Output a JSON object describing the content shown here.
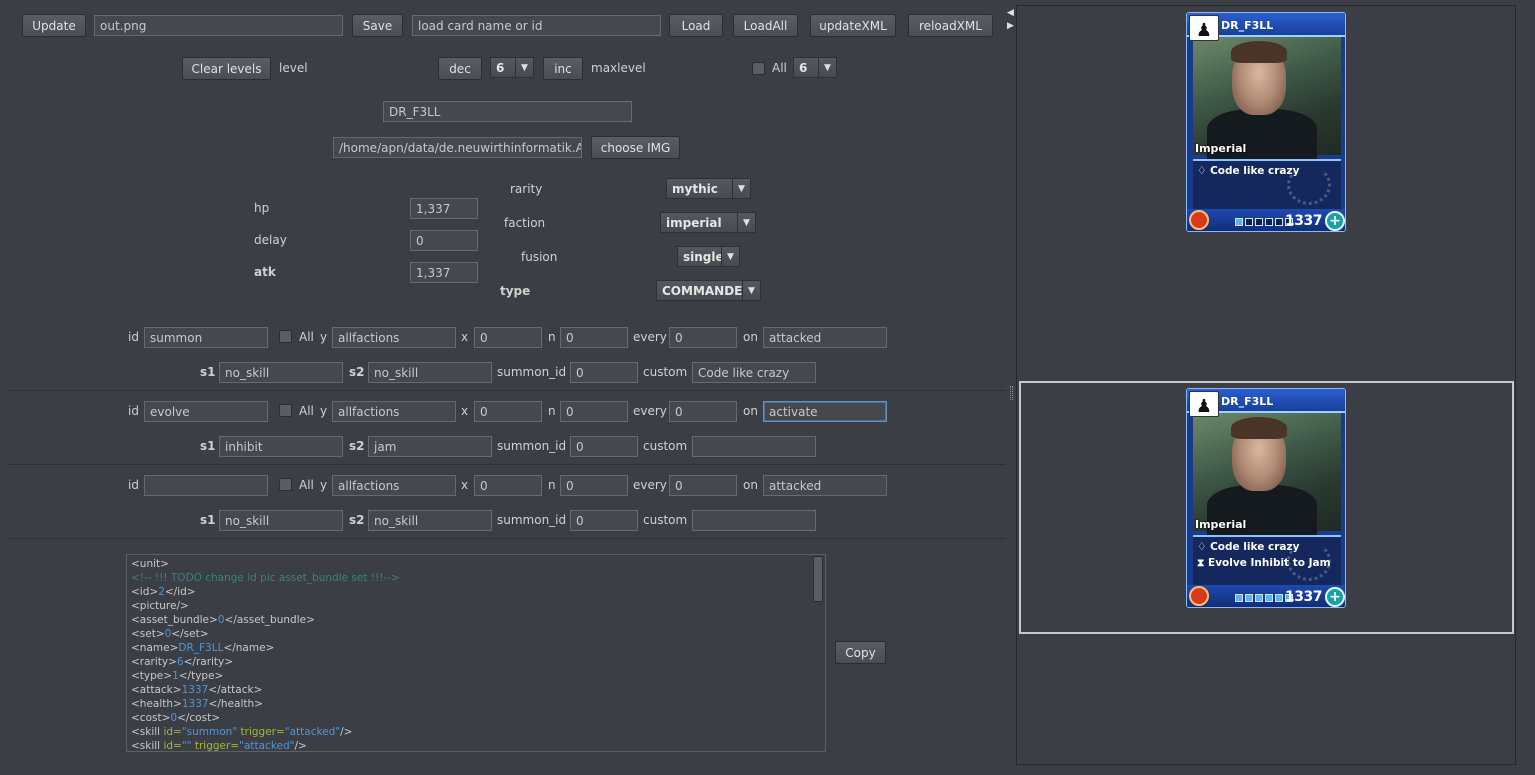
{
  "toolbar": {
    "update": "Update",
    "filename": "out.png",
    "save": "Save",
    "load_placeholder": "load card name or id",
    "load": "Load",
    "load_all": "LoadAll",
    "update_xml": "updateXML",
    "reload_xml": "reloadXML"
  },
  "levels": {
    "clear": "Clear levels",
    "level_label": "level",
    "dec": "dec",
    "level_value": "6",
    "inc": "inc",
    "maxlevel_label": "maxlevel",
    "all_label": "All",
    "max_value": "6"
  },
  "card_name": "DR_F3LL",
  "image_path": "/home/apn/data/de.neuwirthinformatik.Alexa",
  "choose_img": "choose IMG",
  "stats": {
    "hp_label": "hp",
    "hp": "1,337",
    "delay_label": "delay",
    "delay": "0",
    "atk_label": "atk",
    "atk": "1,337",
    "rarity_label": "rarity",
    "rarity": "mythic",
    "faction_label": "faction",
    "faction": "imperial",
    "fusion_label": "fusion",
    "fusion": "single",
    "type_label": "type",
    "type": "COMMANDER"
  },
  "skill_labels": {
    "id": "id",
    "all": "All",
    "y": "y",
    "x": "x",
    "n": "n",
    "every": "every",
    "on": "on",
    "s1": "s1",
    "s2": "s2",
    "summon_id": "summon_id",
    "custom": "custom"
  },
  "skills": [
    {
      "id": "summon",
      "y": "allfactions",
      "x": "0",
      "n": "0",
      "every": "0",
      "on": "attacked",
      "s1": "no_skill",
      "s2": "no_skill",
      "summon_id": "0",
      "custom": "Code like crazy"
    },
    {
      "id": "evolve",
      "y": "allfactions",
      "x": "0",
      "n": "0",
      "every": "0",
      "on": "activate",
      "s1": "inhibit",
      "s2": "jam",
      "summon_id": "0",
      "custom": ""
    },
    {
      "id": "",
      "y": "allfactions",
      "x": "0",
      "n": "0",
      "every": "0",
      "on": "attacked",
      "s1": "no_skill",
      "s2": "no_skill",
      "summon_id": "0",
      "custom": ""
    }
  ],
  "xml_lines": [
    [
      [
        "t",
        "<unit>"
      ]
    ],
    [
      [
        "cm",
        "<!-- !!! TODO change id pic asset_bundle set !!!-->"
      ]
    ],
    [
      [
        "t",
        "<id>"
      ],
      [
        "v",
        "2"
      ],
      [
        "t",
        "</id>"
      ]
    ],
    [
      [
        "t",
        "<picture/>"
      ]
    ],
    [
      [
        "t",
        "<asset_bundle>"
      ],
      [
        "v",
        "0"
      ],
      [
        "t",
        "</asset_bundle>"
      ]
    ],
    [
      [
        "t",
        "<set>"
      ],
      [
        "v",
        "0"
      ],
      [
        "t",
        "</set>"
      ]
    ],
    [
      [
        "t",
        "<name>"
      ],
      [
        "v",
        "DR_F3LL"
      ],
      [
        "t",
        "</name>"
      ]
    ],
    [
      [
        "t",
        "<rarity>"
      ],
      [
        "v",
        "6"
      ],
      [
        "t",
        "</rarity>"
      ]
    ],
    [
      [
        "t",
        "<type>"
      ],
      [
        "v",
        "1"
      ],
      [
        "t",
        "</type>"
      ]
    ],
    [
      [
        "t",
        "<attack>"
      ],
      [
        "v",
        "1337"
      ],
      [
        "t",
        "</attack>"
      ]
    ],
    [
      [
        "t",
        "<health>"
      ],
      [
        "v",
        "1337"
      ],
      [
        "t",
        "</health>"
      ]
    ],
    [
      [
        "t",
        "<cost>"
      ],
      [
        "v",
        "0"
      ],
      [
        "t",
        "</cost>"
      ]
    ],
    [
      [
        "t",
        "<skill "
      ],
      [
        "a",
        "id="
      ],
      [
        "v",
        "\"summon\""
      ],
      [
        "a",
        " trigger="
      ],
      [
        "v",
        "\"attacked\""
      ],
      [
        "t",
        "/>"
      ]
    ],
    [
      [
        "t",
        "<skill "
      ],
      [
        "a",
        "id="
      ],
      [
        "v",
        "\"\""
      ],
      [
        "a",
        " trigger="
      ],
      [
        "v",
        "\"attacked\""
      ],
      [
        "t",
        "/>"
      ]
    ]
  ],
  "copy": "Copy",
  "cards": [
    {
      "name": "DR_F3LL",
      "faction": "Imperial",
      "skills": [
        "Code like crazy"
      ],
      "value": "1337",
      "level": 1,
      "max_level": 6
    },
    {
      "name": "DR_F3LL",
      "faction": "Imperial",
      "skills": [
        "Code like crazy",
        "Evolve Inhibit to Jam"
      ],
      "value": "1337",
      "level": 6,
      "max_level": 6
    }
  ]
}
